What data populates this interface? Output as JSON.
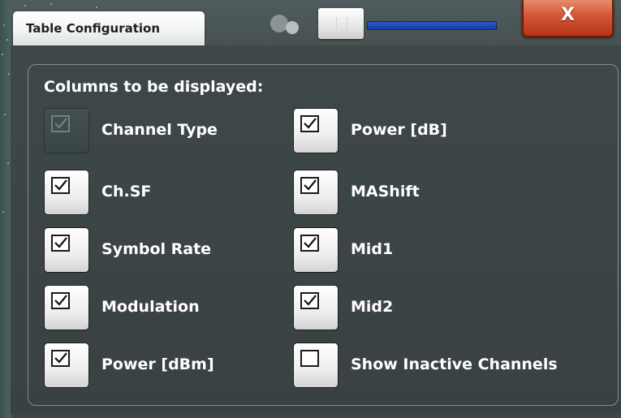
{
  "dialog": {
    "title": "Table Configuration",
    "close_label": "X"
  },
  "group": {
    "title": "Columns to be displayed:"
  },
  "columns_left": [
    {
      "label": "Channel Type",
      "checked": true,
      "enabled": false
    },
    {
      "label": "Ch.SF",
      "checked": true,
      "enabled": true
    },
    {
      "label": "Symbol Rate",
      "checked": true,
      "enabled": true
    },
    {
      "label": "Modulation",
      "checked": true,
      "enabled": true
    },
    {
      "label": "Power [dBm]",
      "checked": true,
      "enabled": true
    }
  ],
  "columns_right": [
    {
      "label": "Power [dB]",
      "checked": true,
      "enabled": true
    },
    {
      "label": "MAShift",
      "checked": true,
      "enabled": true
    },
    {
      "label": "Mid1",
      "checked": true,
      "enabled": true
    },
    {
      "label": "Mid2",
      "checked": true,
      "enabled": true
    },
    {
      "label": "Show Inactive Channels",
      "checked": false,
      "enabled": true
    }
  ],
  "colors": {
    "panel": "#3f4849",
    "close_button": "#d45a38",
    "slider": "#2a57c8",
    "text": "#ffffff"
  }
}
